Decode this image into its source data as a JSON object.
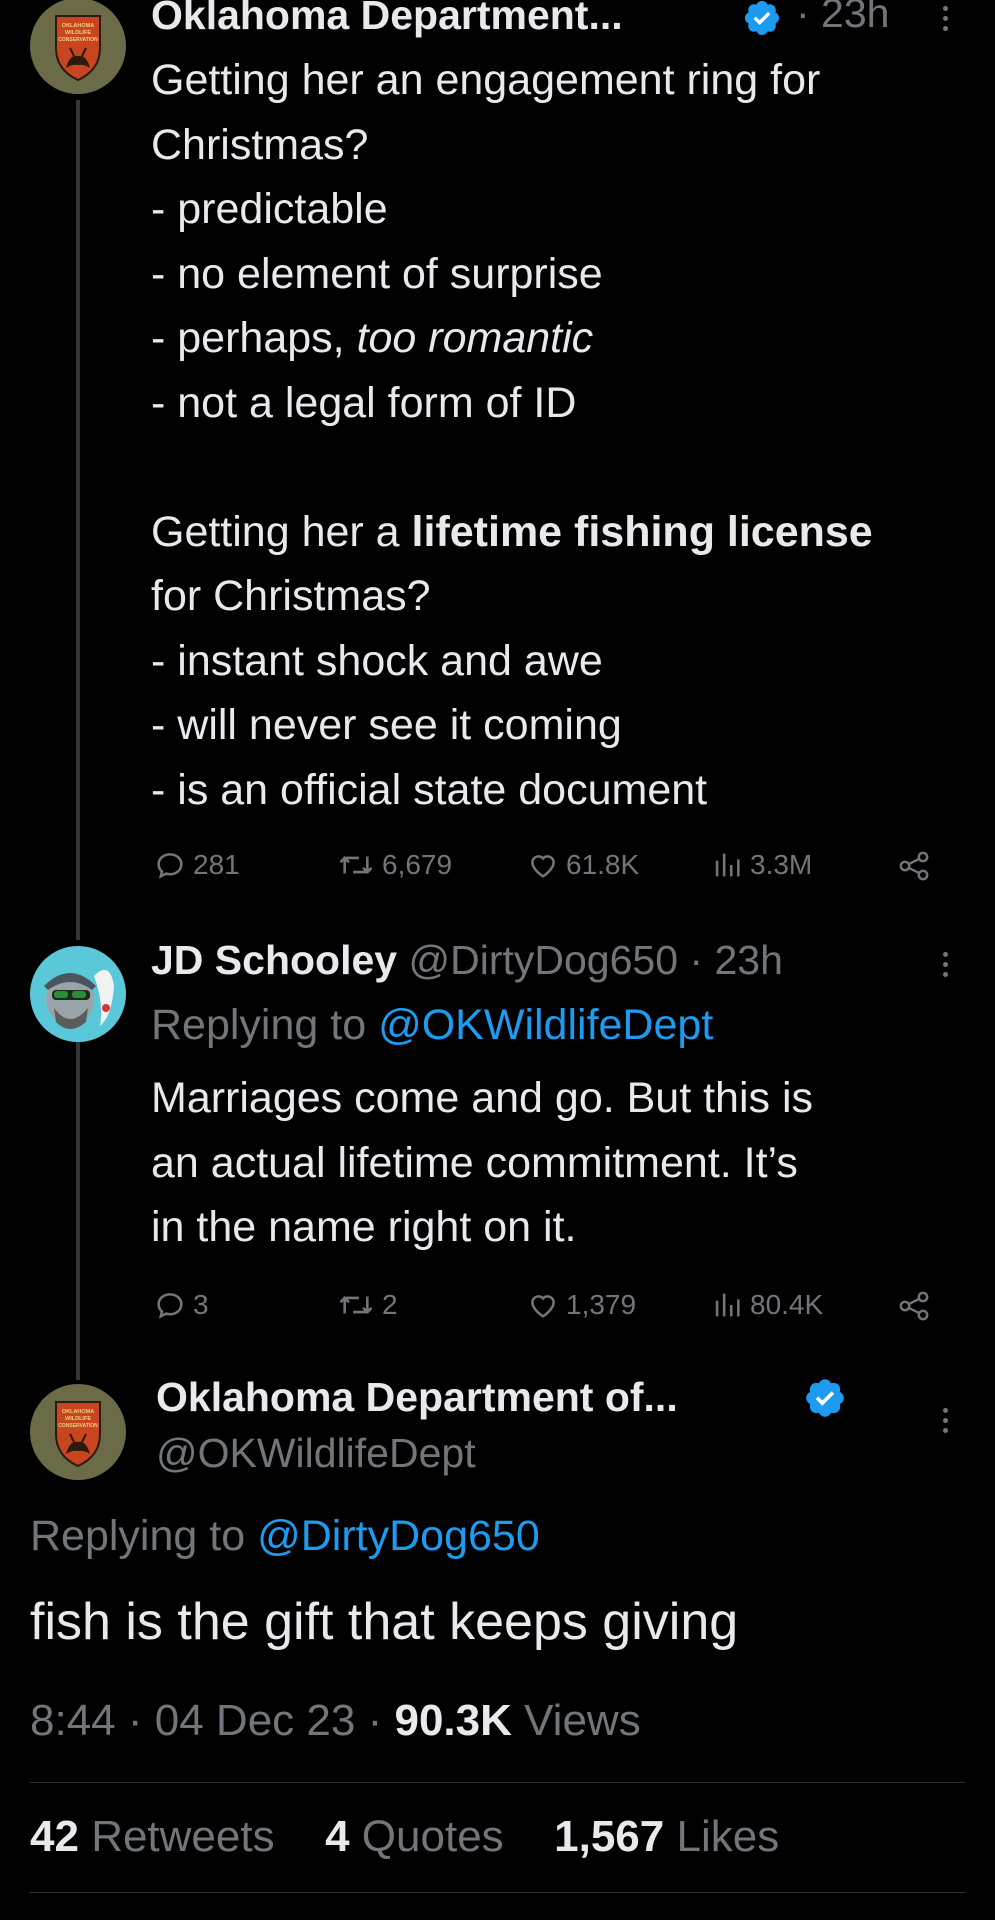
{
  "tweet1": {
    "name": "Oklahoma Department...",
    "time": "· 23h",
    "lines": [
      {
        "text": "Getting her an engagement ring for"
      },
      {
        "text": "Christmas?"
      },
      {
        "text": "- predictable"
      },
      {
        "text": "- no element of surprise"
      },
      {
        "pre": "- perhaps, ",
        "italic": "too romantic"
      },
      {
        "text": "- not a legal form of ID"
      },
      {
        "text": ""
      },
      {
        "pre": "Getting her a ",
        "bold": "lifetime fishing license"
      },
      {
        "text": "for Christmas?"
      },
      {
        "text": "- instant shock and awe"
      },
      {
        "text": "- will never see it coming"
      },
      {
        "text": "- is an official state document"
      }
    ],
    "replies": "281",
    "retweets": "6,679",
    "likes": "61.8K",
    "views": "3.3M"
  },
  "tweet2": {
    "name": "JD Schooley",
    "handle": "@DirtyDog650",
    "time": "· 23h",
    "replying_prefix": "Replying to ",
    "replying_handle": "@OKWildlifeDept",
    "lines": [
      "Marriages come and go. But this is",
      "an actual lifetime commitment. It’s",
      "in the name right on it."
    ],
    "replies": "3",
    "retweets": "2",
    "likes": "1,379",
    "views": "80.4K"
  },
  "tweet3": {
    "name": "Oklahoma Department of...",
    "handle": "@OKWildlifeDept",
    "replying_prefix": "Replying to ",
    "replying_handle": "@DirtyDog650",
    "text": "fish is the gift that keeps giving",
    "time": "8:44",
    "date": "04 Dec 23",
    "views_count": "90.3K",
    "views_label": "Views",
    "sep": "·",
    "stats": {
      "retweets_count": "42",
      "retweets_label": "Retweets",
      "quotes_count": "4",
      "quotes_label": "Quotes",
      "likes_count": "1,567",
      "likes_label": "Likes"
    }
  },
  "logo": {
    "lines": [
      "OKLAHOMA",
      "WILDLIFE",
      "CONSERVATION"
    ]
  },
  "colors": {
    "accent": "#1d9bf0",
    "text": "#e7e9ea",
    "muted": "#71767b",
    "background": "#000000"
  },
  "icons": [
    "verified-badge-icon",
    "reply-icon",
    "retweet-icon",
    "like-icon",
    "views-icon",
    "share-icon",
    "more-icon"
  ]
}
